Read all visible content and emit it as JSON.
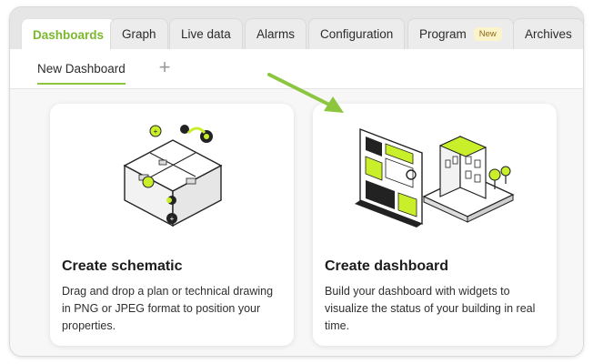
{
  "tabs": [
    {
      "label": "Dashboards",
      "active": true
    },
    {
      "label": "Graph"
    },
    {
      "label": "Live data"
    },
    {
      "label": "Alarms"
    },
    {
      "label": "Configuration"
    },
    {
      "label": "Program",
      "badge": "New"
    },
    {
      "label": "Archives"
    }
  ],
  "subtabs": {
    "active_label": "New Dashboard",
    "add_icon": "plus-icon"
  },
  "cards": {
    "schematic": {
      "title": "Create schematic",
      "description": "Drag and drop a plan or technical drawing in PNG or JPEG format to position your properties."
    },
    "dashboard": {
      "title": "Create dashboard",
      "description": "Build your dashboard with widgets to visualize the status of your building in real time."
    }
  },
  "colors": {
    "accent": "#8cc63f",
    "arrow": "#8cc63f",
    "badge_bg": "#fbf3c9"
  }
}
